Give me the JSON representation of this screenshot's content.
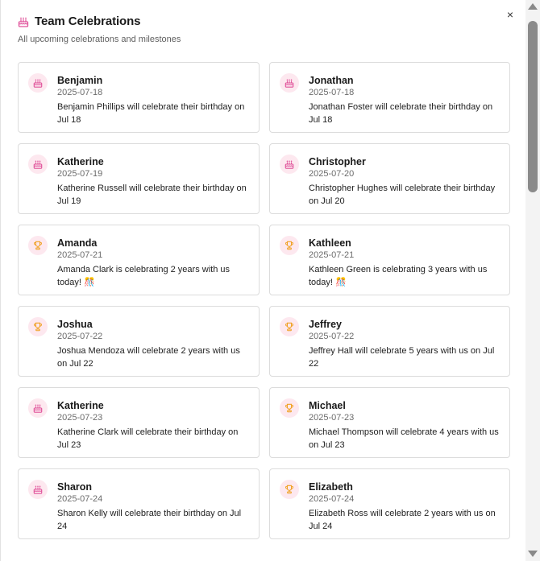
{
  "modal": {
    "title": "Team Celebrations",
    "subtitle": "All upcoming celebrations and milestones",
    "close_symbol": "×"
  },
  "colors": {
    "birthday_icon": "#e0529a",
    "anniversary_icon": "#f0a020",
    "avatar_bg": "#fde8ef"
  },
  "celebrations": [
    {
      "type": "birthday",
      "icon": "cake-icon",
      "name": "Benjamin",
      "date": "2025-07-18",
      "message": "Benjamin Phillips will celebrate their birthday on Jul 18"
    },
    {
      "type": "birthday",
      "icon": "cake-icon",
      "name": "Jonathan",
      "date": "2025-07-18",
      "message": "Jonathan Foster will celebrate their birthday on Jul 18"
    },
    {
      "type": "birthday",
      "icon": "cake-icon",
      "name": "Katherine",
      "date": "2025-07-19",
      "message": "Katherine Russell will celebrate their birthday on Jul 19"
    },
    {
      "type": "birthday",
      "icon": "cake-icon",
      "name": "Christopher",
      "date": "2025-07-20",
      "message": "Christopher Hughes will celebrate their birthday on Jul 20"
    },
    {
      "type": "anniversary",
      "icon": "trophy-icon",
      "name": "Amanda",
      "date": "2025-07-21",
      "message": "Amanda Clark is celebrating 2 years with us today! 🎊"
    },
    {
      "type": "anniversary",
      "icon": "trophy-icon",
      "name": "Kathleen",
      "date": "2025-07-21",
      "message": "Kathleen Green is celebrating 3 years with us today! 🎊"
    },
    {
      "type": "anniversary",
      "icon": "trophy-icon",
      "name": "Joshua",
      "date": "2025-07-22",
      "message": "Joshua Mendoza will celebrate 2 years with us on Jul 22"
    },
    {
      "type": "anniversary",
      "icon": "trophy-icon",
      "name": "Jeffrey",
      "date": "2025-07-22",
      "message": "Jeffrey Hall will celebrate 5 years with us on Jul 22"
    },
    {
      "type": "birthday",
      "icon": "cake-icon",
      "name": "Katherine",
      "date": "2025-07-23",
      "message": "Katherine Clark will celebrate their birthday on Jul 23"
    },
    {
      "type": "anniversary",
      "icon": "trophy-icon",
      "name": "Michael",
      "date": "2025-07-23",
      "message": "Michael Thompson will celebrate 4 years with us on Jul 23"
    },
    {
      "type": "birthday",
      "icon": "cake-icon",
      "name": "Sharon",
      "date": "2025-07-24",
      "message": "Sharon Kelly will celebrate their birthday on Jul 24"
    },
    {
      "type": "anniversary",
      "icon": "trophy-icon",
      "name": "Elizabeth",
      "date": "2025-07-24",
      "message": "Elizabeth Ross will celebrate 2 years with us on Jul 24"
    }
  ]
}
